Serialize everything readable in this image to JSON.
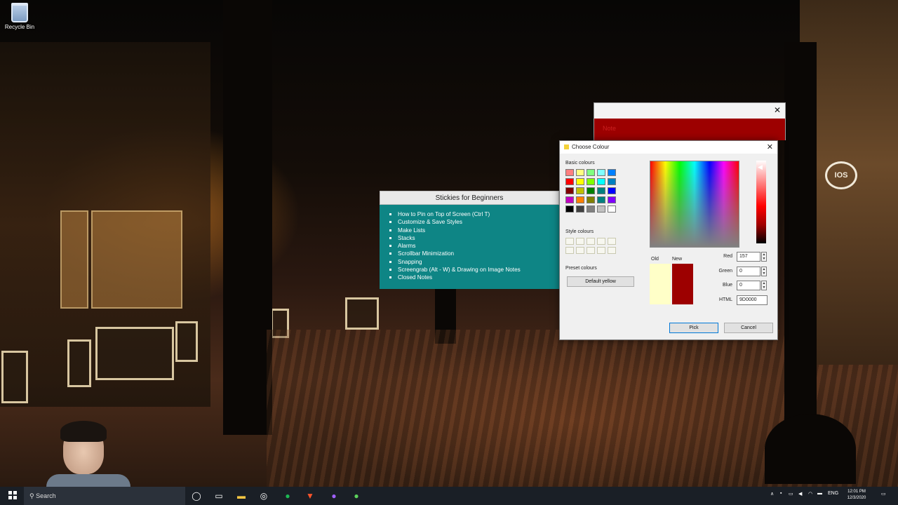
{
  "desktop": {
    "recycle_bin_label": "Recycle Bin",
    "sign_text": "IOS"
  },
  "red_note": {
    "body_text": "Note"
  },
  "stickies_note": {
    "title": "Stickies for Beginners",
    "items": [
      "How to Pin on Top of Screen (Ctrl T)",
      "Customize & Save Styles",
      "Make Lists",
      "Stacks",
      "Alarms",
      "Scrollbar Minimization",
      "Snapping",
      "Screengrab (Alt - W) & Drawing on Image Notes",
      "Closed Notes"
    ],
    "background_color": "#0e8585"
  },
  "colour_dialog": {
    "title": "Choose Colour",
    "basic_colours_label": "Basic colours",
    "style_colours_label": "Style colours",
    "preset_colours_label": "Preset colours",
    "default_yellow_button": "Default yellow",
    "old_label": "Old",
    "new_label": "New",
    "red_label": "Red",
    "green_label": "Green",
    "blue_label": "Blue",
    "html_label": "HTML",
    "red_value": "157",
    "green_value": "0",
    "blue_value": "0",
    "html_value": "9D0000",
    "pick_button": "Pick",
    "cancel_button": "Cancel",
    "old_colour": "#ffffc8",
    "new_colour": "#9d0000",
    "basic_colours": [
      "#ff8080",
      "#ffff80",
      "#80ff80",
      "#80ffff",
      "#0080ff",
      "#ff0000",
      "#ffff00",
      "#80ff00",
      "#00ffff",
      "#0080c0",
      "#800000",
      "#c0c000",
      "#008000",
      "#008080",
      "#0000ff",
      "#c000c0",
      "#ff8000",
      "#808000",
      "#008080",
      "#8000ff",
      "#000000",
      "#404040",
      "#808080",
      "#c0c0c0",
      "#ffffff"
    ]
  },
  "taskbar": {
    "search_text": "Search",
    "language": "ENG",
    "time": "12:01 PM",
    "date": "12/3/2020"
  }
}
